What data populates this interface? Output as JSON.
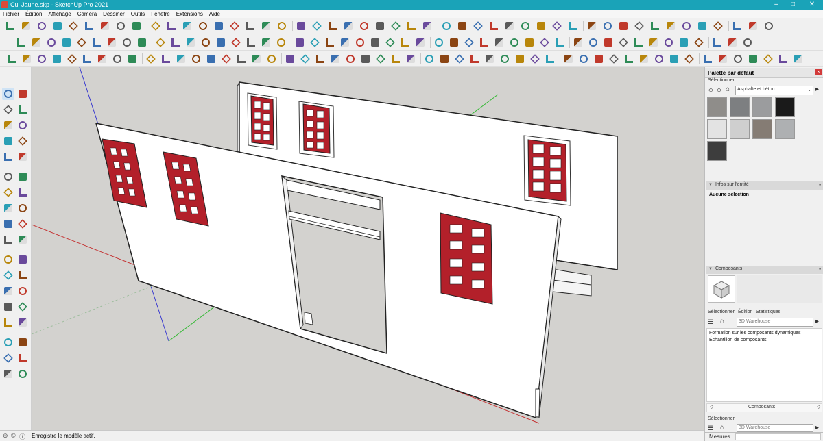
{
  "window": {
    "title": "Cul Jaune.skp - SketchUp Pro 2021",
    "controls": [
      "minimize-icon",
      "maximize-icon",
      "close-icon"
    ]
  },
  "menu": [
    "Fichier",
    "Édition",
    "Affichage",
    "Caméra",
    "Dessiner",
    "Outils",
    "Fenêtre",
    "Extensions",
    "Aide"
  ],
  "toolbars": {
    "row1_icons": [
      "new-file-icon",
      "open-icon",
      "save-icon",
      "cut-icon",
      "copy-icon",
      "paste-icon",
      "erase-icon",
      "undo-icon",
      "redo-icon",
      "print-icon",
      "model-info-icon",
      "circle-dot-icon",
      "select-icon",
      "eraser-icon",
      "pencil-icon",
      "arc-icon",
      "rectangle-icon",
      "push-pull-icon",
      "move-icon",
      "rotate-icon",
      "scale-icon",
      "tape-icon",
      "text-icon",
      "paint-icon",
      "orbit-icon",
      "pan-icon",
      "zoom-icon",
      "zoom-extents-icon",
      "component-icon",
      "sandbox-icon",
      "warehouse-icon",
      "user-icon",
      "iso-view-icon",
      "top-view-icon",
      "front-view-icon",
      "right-view-icon",
      "back-view-icon",
      "left-view-icon",
      "xray-icon",
      "wireframe-icon",
      "hidden-line-icon",
      "shaded-icon",
      "textured-icon",
      "monochrome-icon"
    ],
    "status_accent": "#1aa3b8"
  },
  "left_toolbar": {
    "icons": [
      "select-icon",
      "component-icon",
      "paint-bucket-icon",
      "eraser-icon",
      "line-icon",
      "freehand-icon",
      "rectangle-icon",
      "rotated-rectangle-icon",
      "circle-icon",
      "polygon-icon",
      "arc-icon",
      "pie-icon",
      "move-icon",
      "push-pull-icon",
      "rotate-icon",
      "follow-me-icon",
      "tape-measure-icon",
      "text-icon",
      "protractor-icon",
      "axes-icon",
      "dimension-icon",
      "3d-text-icon",
      "orbit-icon",
      "pan-icon",
      "zoom-icon",
      "zoom-window-icon",
      "zoom-extents-icon",
      "previous-view-icon",
      "section-plane-icon",
      "position-camera-icon",
      "walk-icon",
      "look-around-icon",
      "warehouse-icon",
      "extension-icon",
      "share-icon",
      "layout-icon"
    ]
  },
  "panel": {
    "title": "Palette par défaut",
    "materials": {
      "section_label": "Sélectionner",
      "dropdown_value": "Asphalte et béton",
      "swatch_colors": [
        "#8f8d8a",
        "#7d7f81",
        "#9b9c9e",
        "#1a1a1a",
        "#e3e3e3",
        "#cfcfcf",
        "#857c74",
        "#aeb0b2",
        "#3d3d3d"
      ]
    },
    "entity_info": {
      "header": "Infos sur l'entité",
      "text": "Aucune sélection"
    },
    "components": {
      "header": "Composants",
      "tabs": [
        "Sélectionner",
        "Édition",
        "Statistiques"
      ],
      "search_placeholder": "3D Warehouse",
      "items": [
        "Formation sur les composants dynamiques",
        "Échantillon de composants"
      ],
      "footer_label": "Composants"
    },
    "bottom": {
      "section_label": "Sélectionner",
      "search_placeholder": "3D Warehouse",
      "measures_label": "Mesures"
    }
  },
  "status": {
    "text": "Enregistre le modèle actif."
  },
  "colors": {
    "window_red": "#b3202a",
    "wall_white": "#ffffff",
    "viewport_bg": "#d3d2cf",
    "axis_red": "#c43131",
    "axis_green": "#33b833",
    "axis_blue": "#3b3bcf"
  }
}
